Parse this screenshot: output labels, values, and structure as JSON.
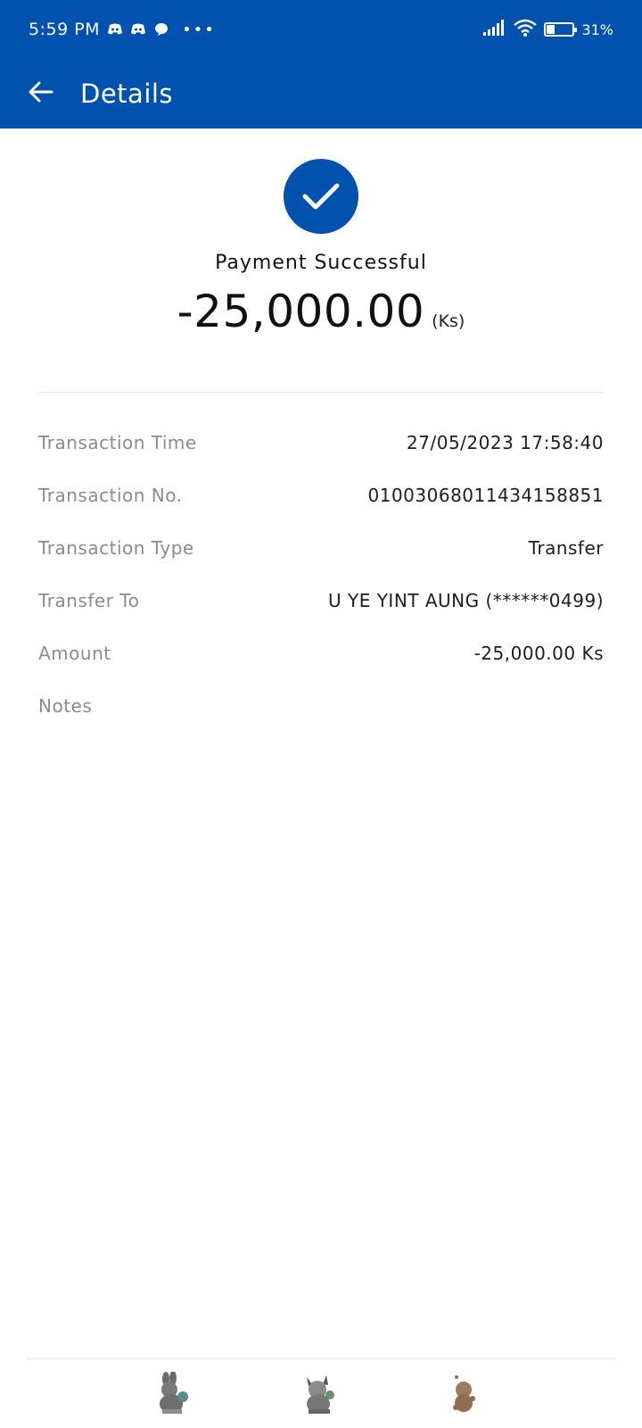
{
  "colors": {
    "brand": "#0052AE",
    "label": "#8C8C8C",
    "value": "#1E1E1E"
  },
  "status_bar": {
    "time": "5:59 PM",
    "notification_icons": [
      "discord-icon",
      "discord-icon",
      "chat-bubble-icon"
    ],
    "overflow": "•••",
    "battery_percent": "31%",
    "battery_level": 0.31
  },
  "toolbar": {
    "title": "Details",
    "back_icon": "arrow-left-icon"
  },
  "result": {
    "icon": "check-circle-icon",
    "message": "Payment Successful",
    "amount": "-25,000.00",
    "currency": "(Ks)"
  },
  "details": [
    {
      "label": "Transaction Time",
      "value": "27/05/2023 17:58:40"
    },
    {
      "label": "Transaction No.",
      "value": "01003068011434158851"
    },
    {
      "label": "Transaction Type",
      "value": "Transfer"
    },
    {
      "label": "Transfer To",
      "value": "U YE YINT AUNG (******0499)"
    },
    {
      "label": "Amount",
      "value": "-25,000.00 Ks"
    },
    {
      "label": "Notes",
      "value": ""
    }
  ],
  "bottom_bar": {
    "items": [
      "sticker-bunny-icon",
      "sticker-cat-icon",
      "sticker-bear-icon"
    ]
  }
}
